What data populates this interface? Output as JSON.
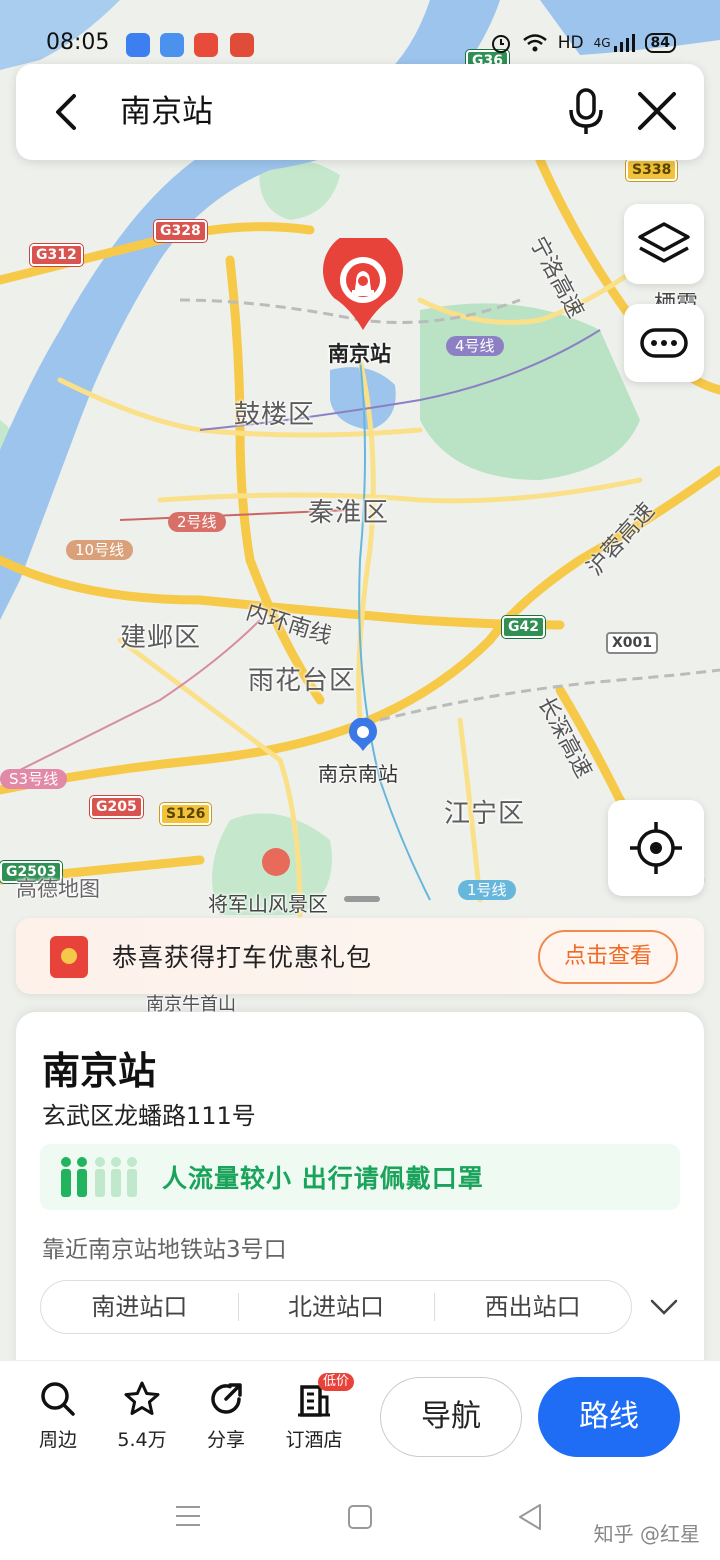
{
  "status_bar": {
    "time": "08:05",
    "network": "HD",
    "net_type": "4G",
    "battery": "84",
    "notification_icons": [
      "infinity-app-icon",
      "cloud-app-icon",
      "toutiao-app-icon",
      "red-app-icon"
    ]
  },
  "search": {
    "query": "南京站"
  },
  "map": {
    "districts": [
      "鼓楼区",
      "秦淮区",
      "建邺区",
      "雨花台区",
      "江宁区"
    ],
    "stations": {
      "main": "南京站",
      "south": "南京南站"
    },
    "roads": [
      "宁洛高速",
      "沪蓉高速",
      "内环南线",
      "长深高速"
    ],
    "highway_shields": [
      "G36",
      "S338",
      "G312",
      "G328",
      "G42",
      "X001",
      "G205",
      "S126",
      "G2503"
    ],
    "metro_lines": [
      "4号线",
      "2号线",
      "10号线",
      "S3号线",
      "1号线"
    ],
    "places": [
      "高德地图",
      "将军山风景区",
      "栖霞",
      "南京牛首山"
    ]
  },
  "promo": {
    "text": "恭喜获得打车优惠礼包",
    "button": "点击查看"
  },
  "poi": {
    "name": "南京站",
    "address": "玄武区龙蟠路111号",
    "crowd_status": "人流量较小 出行请佩戴口罩",
    "nearby": "靠近南京站地铁站3号口",
    "entrances": [
      "南进站口",
      "北进站口",
      "西出站口"
    ]
  },
  "actions": {
    "nearby": "周边",
    "favorites": "5.4万",
    "share": "分享",
    "hotel": "订酒店",
    "hotel_badge": "低价",
    "navigate": "导航",
    "route": "路线"
  },
  "watermark": "知乎 @红星",
  "colors": {
    "primary_blue": "#1f6cf5",
    "promo_orange": "#ef6a24",
    "crowd_green": "#1aa35a",
    "marker_red": "#e8433a",
    "water": "#9cc4ec",
    "green_area": "#b9e3c4",
    "road_yellow": "#f7c948"
  }
}
